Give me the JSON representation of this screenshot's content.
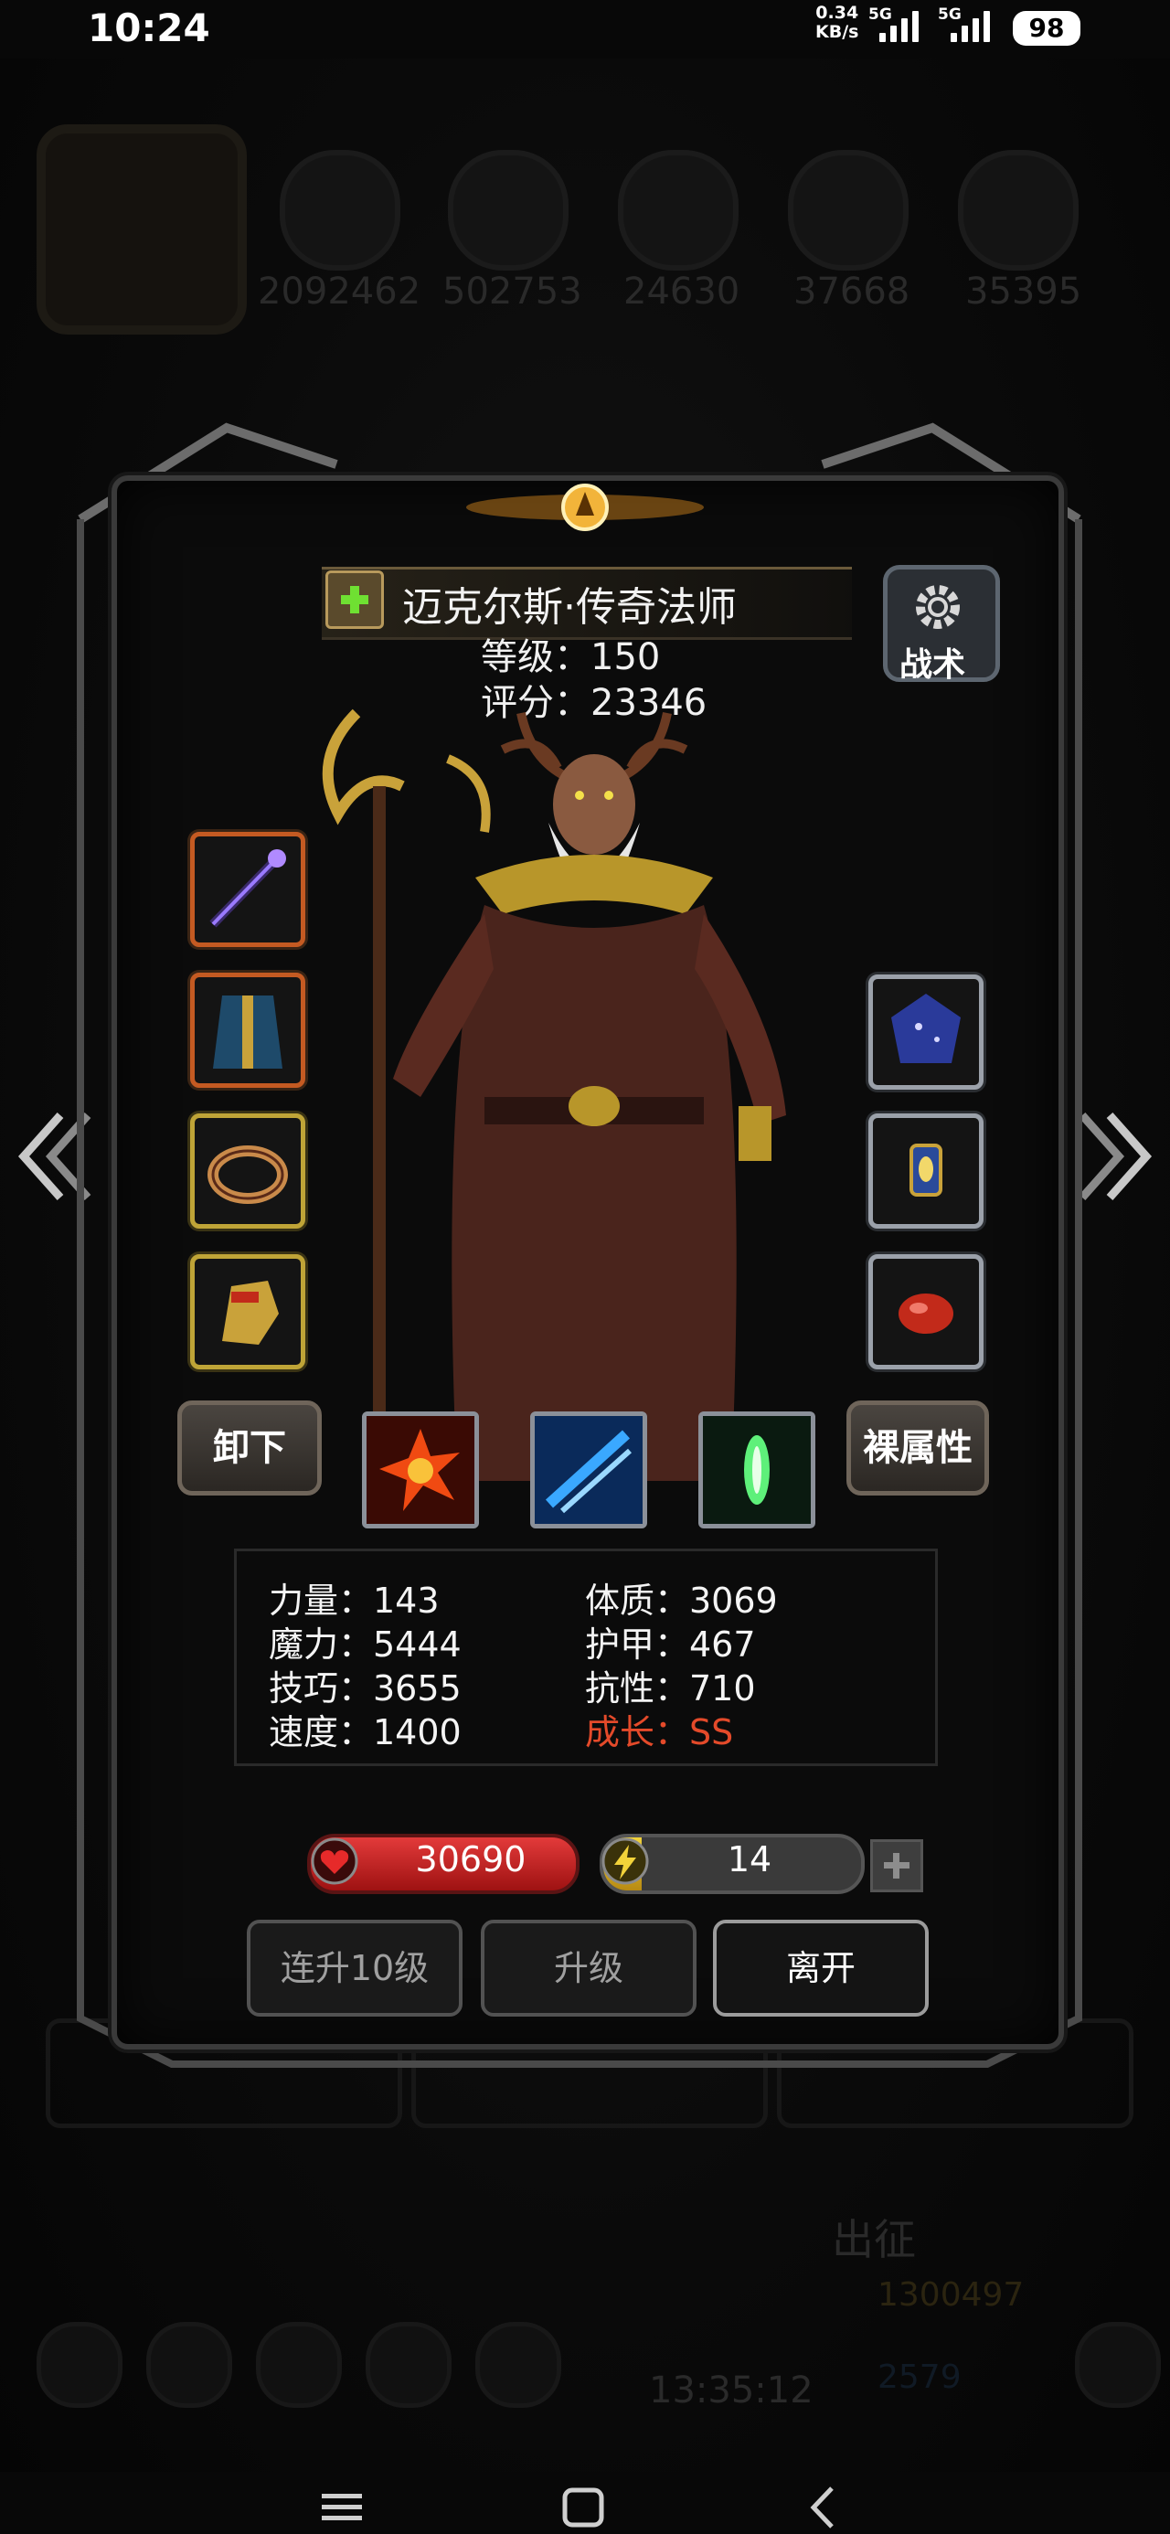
{
  "status_bar": {
    "time": "10:24",
    "net_speed_value": "0.34",
    "net_speed_unit": "KB/s",
    "signal_1": "5G",
    "signal_2": "5G",
    "battery": "98"
  },
  "background": {
    "resources": [
      "2092462",
      "502753",
      "24630",
      "37668",
      "35395"
    ],
    "chuzheng_label": "出征",
    "gold": "1300497",
    "gems": "2579",
    "timer": "13:35:12"
  },
  "hero": {
    "name": "迈克尔斯·传奇法师",
    "level_label": "等级：150",
    "score_label": "评分：23346"
  },
  "tactics_label": "战术",
  "equipment_left": [
    {
      "icon": "staff-weapon-icon",
      "rarity": "orange"
    },
    {
      "icon": "robe-armor-icon",
      "rarity": "orange"
    },
    {
      "icon": "ring-icon",
      "rarity": "gold"
    },
    {
      "icon": "gauntlet-icon",
      "rarity": "gold"
    }
  ],
  "equipment_right": [
    {
      "icon": "gem-orb-icon",
      "rarity": "silver"
    },
    {
      "icon": "lantern-icon",
      "rarity": "silver"
    },
    {
      "icon": "red-stone-icon",
      "rarity": "silver"
    }
  ],
  "unequip_label": "卸下",
  "base_attr_label": "裸属性",
  "skills": [
    {
      "icon": "fire-burst-skill-icon",
      "color": "#f04a12"
    },
    {
      "icon": "ice-slash-skill-icon",
      "color": "#3aa8ff"
    },
    {
      "icon": "green-light-skill-icon",
      "color": "#5ef07a"
    }
  ],
  "stats": {
    "strength": "力量：143",
    "magic": "魔力：5444",
    "skill": "技巧：3655",
    "speed": "速度：1400",
    "constitution": "体质：3069",
    "armor": "护甲：467",
    "resistance": "抗性：710",
    "growth": "成长：SS"
  },
  "hp": "30690",
  "energy": {
    "value": "14",
    "fill_fraction": 0.15
  },
  "buttons": {
    "level_up_10": "连升10级",
    "level_up": "升级",
    "leave": "离开"
  },
  "colors": {
    "growth": "#e44a2a",
    "hp": "#d42222",
    "energy": "#f2c92a"
  }
}
